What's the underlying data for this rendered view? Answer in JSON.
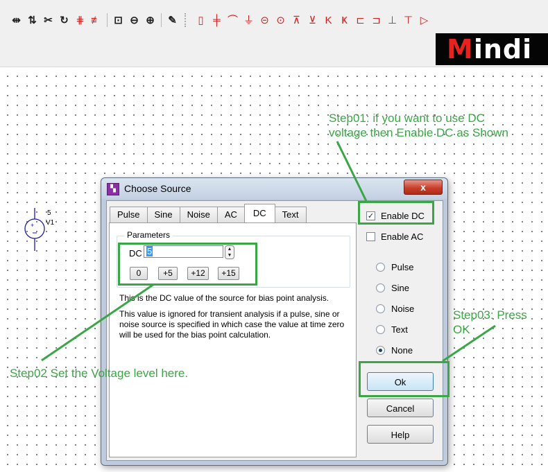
{
  "toolbar": {
    "icons": [
      "flip-horizontal-icon",
      "flip-vertical-icon",
      "cut-icon",
      "rotate-icon",
      "bus-icon",
      "bus-entry-icon",
      "zoom-area-icon",
      "zoom-out-icon",
      "zoom-in-icon",
      "pencil-icon",
      "resistor-icon",
      "capacitor-icon",
      "inductor-icon",
      "ground-icon",
      "voltage-source-icon",
      "current-source-icon",
      "diode-icon",
      "zener-icon",
      "npn-transistor-icon",
      "pnp-transistor-icon",
      "nmos-icon",
      "pmos-icon",
      "njfet-icon",
      "pjfet-icon",
      "opamp-icon"
    ],
    "brand_first": "M",
    "brand_rest": "indi"
  },
  "schematic": {
    "component_value": "5",
    "component_ref": "V1"
  },
  "dialog": {
    "title": "Choose Source",
    "close_label": "x",
    "tabs": [
      {
        "label": "Pulse",
        "active": false
      },
      {
        "label": "Sine",
        "active": false
      },
      {
        "label": "Noise",
        "active": false
      },
      {
        "label": "AC",
        "active": false
      },
      {
        "label": "DC",
        "active": true
      },
      {
        "label": "Text",
        "active": false
      }
    ],
    "parameters": {
      "legend": "Parameters",
      "dc_label": "DC",
      "dc_value": "5",
      "presets": [
        "0",
        "+5",
        "+12",
        "+15"
      ]
    },
    "description_1": "This is the DC value of the source for bias point analysis.",
    "description_2": "This value is ignored for transient analysis if a pulse, sine or noise source is specified in which case the value at time zero will be used for the bias point calculation.",
    "enable_dc": {
      "label": "Enable DC",
      "checked": true
    },
    "enable_ac": {
      "label": "Enable AC",
      "checked": false
    },
    "radios": [
      {
        "label": "Pulse",
        "selected": false
      },
      {
        "label": "Sine",
        "selected": false
      },
      {
        "label": "Noise",
        "selected": false
      },
      {
        "label": "Text",
        "selected": false
      },
      {
        "label": "None",
        "selected": true
      }
    ],
    "ok_label": "Ok",
    "cancel_label": "Cancel",
    "help_label": "Help"
  },
  "annotations": {
    "step01_line1": "Step01: if you want to use DC",
    "step01_line2": "voltage then Enable DC as Shown",
    "step02": "Step02 Set the Voltage level here.",
    "step03_line1": "Step03: Press",
    "step03_line2": "OK",
    "color": "#3aa645"
  }
}
